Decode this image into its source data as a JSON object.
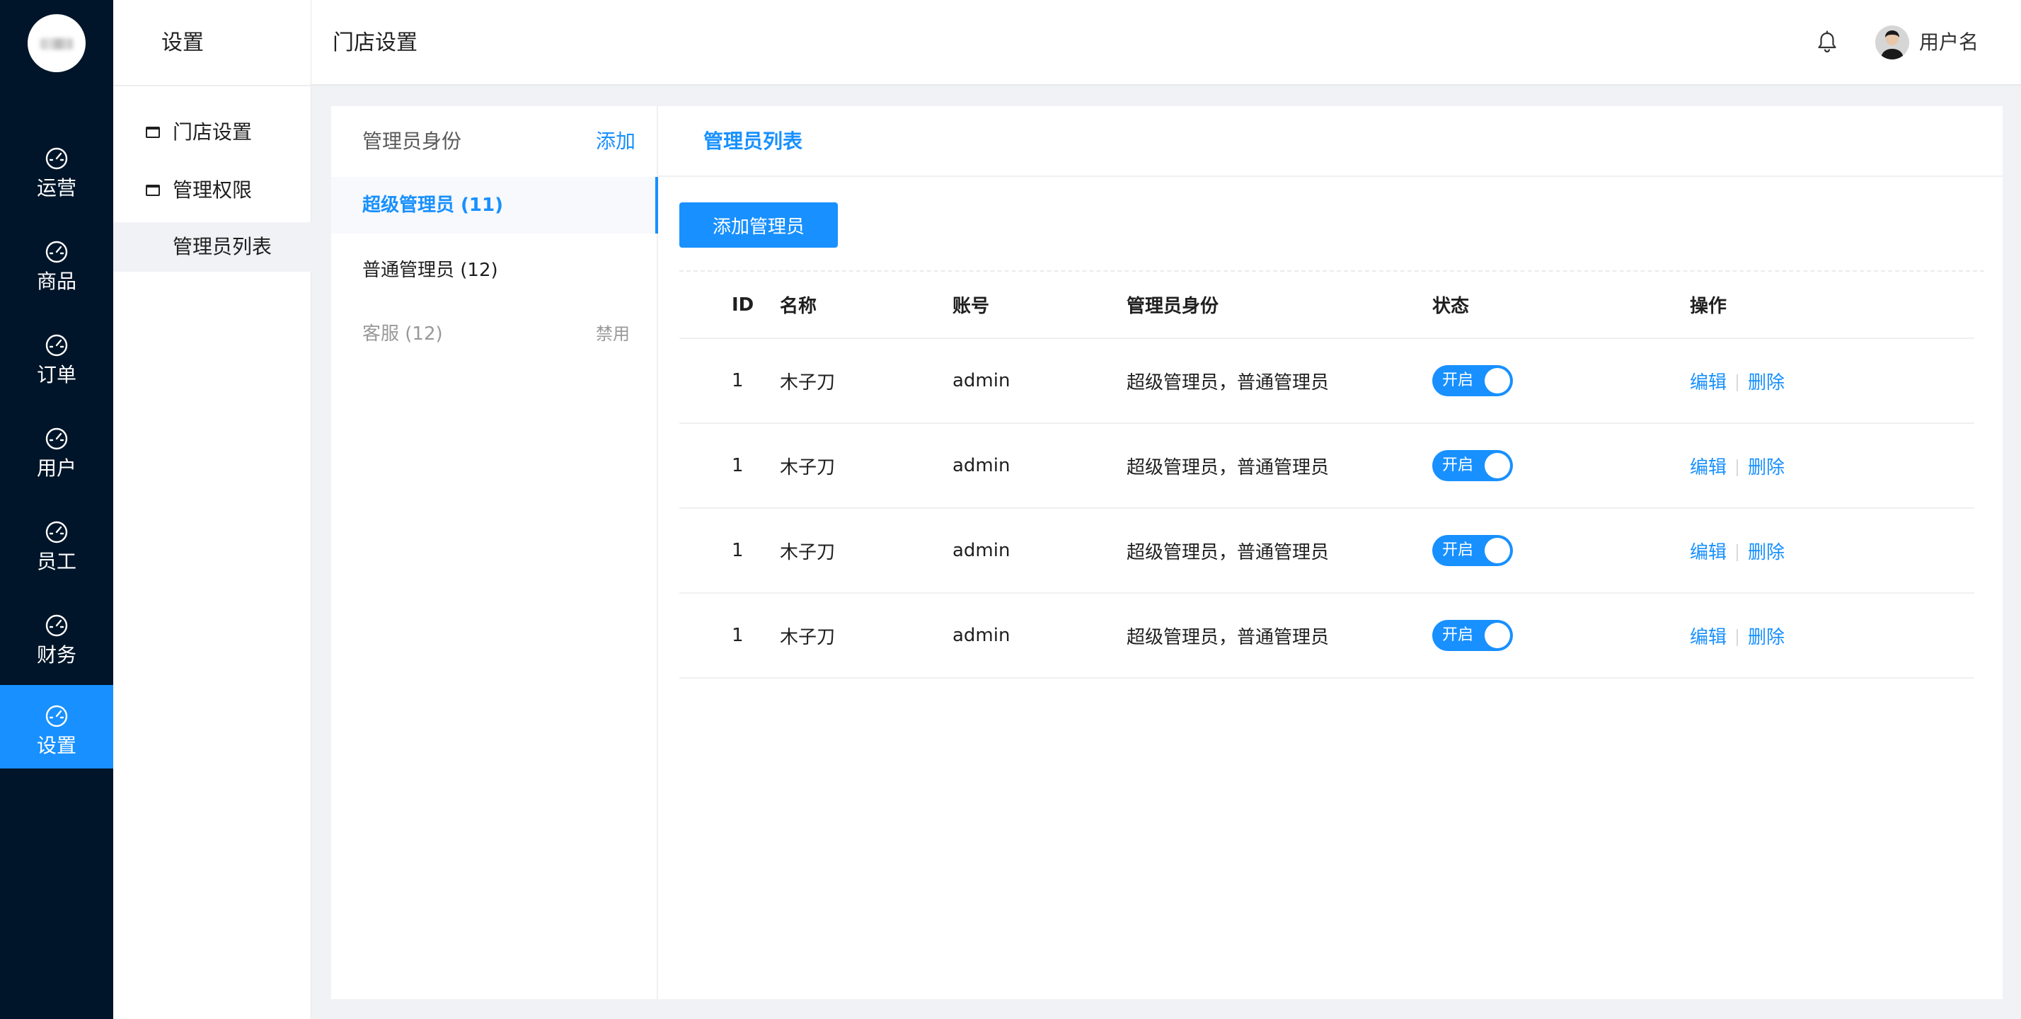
{
  "nav": {
    "items": [
      {
        "label": "运营",
        "icon": "dashboard-icon",
        "active": false
      },
      {
        "label": "商品",
        "icon": "dashboard-icon",
        "active": false
      },
      {
        "label": "订单",
        "icon": "dashboard-icon",
        "active": false
      },
      {
        "label": "用户",
        "icon": "dashboard-icon",
        "active": false
      },
      {
        "label": "员工",
        "icon": "dashboard-icon",
        "active": false
      },
      {
        "label": "财务",
        "icon": "dashboard-icon",
        "active": false
      },
      {
        "label": "设置",
        "icon": "dashboard-icon",
        "active": true
      }
    ],
    "active_color": "#1890ff",
    "bg_color": "#001529"
  },
  "subnav": {
    "title": "设置",
    "items": [
      {
        "label": "门店设置",
        "icon": "window-icon"
      },
      {
        "label": "管理权限",
        "icon": "window-icon"
      },
      {
        "label": "管理员列表",
        "active": true
      }
    ]
  },
  "header": {
    "page_title": "门店设置",
    "username": "用户名",
    "bell_icon": "bell-icon"
  },
  "roles": {
    "title": "管理员身份",
    "add_label": "添加",
    "items": [
      {
        "name": "超级管理员 (11)",
        "active": true
      },
      {
        "name": "普通管理员 (12)",
        "active": false
      },
      {
        "name": "客服 (12)",
        "tag": "禁用",
        "disabled": true
      }
    ]
  },
  "content": {
    "tab": "管理员列表",
    "add_button": "添加管理员",
    "columns": [
      "ID",
      "名称",
      "账号",
      "管理员身份",
      "状态",
      "操作"
    ],
    "rows": [
      {
        "id": "1",
        "name": "木子刀",
        "account": "admin",
        "roles": "超级管理员，普通管理员",
        "status": "开启",
        "edit": "编辑",
        "delete": "删除"
      },
      {
        "id": "1",
        "name": "木子刀",
        "account": "admin",
        "roles": "超级管理员，普通管理员",
        "status": "开启",
        "edit": "编辑",
        "delete": "删除"
      },
      {
        "id": "1",
        "name": "木子刀",
        "account": "admin",
        "roles": "超级管理员，普通管理员",
        "status": "开启",
        "edit": "编辑",
        "delete": "删除"
      },
      {
        "id": "1",
        "name": "木子刀",
        "account": "admin",
        "roles": "超级管理员，普通管理员",
        "status": "开启",
        "edit": "编辑",
        "delete": "删除"
      }
    ]
  }
}
